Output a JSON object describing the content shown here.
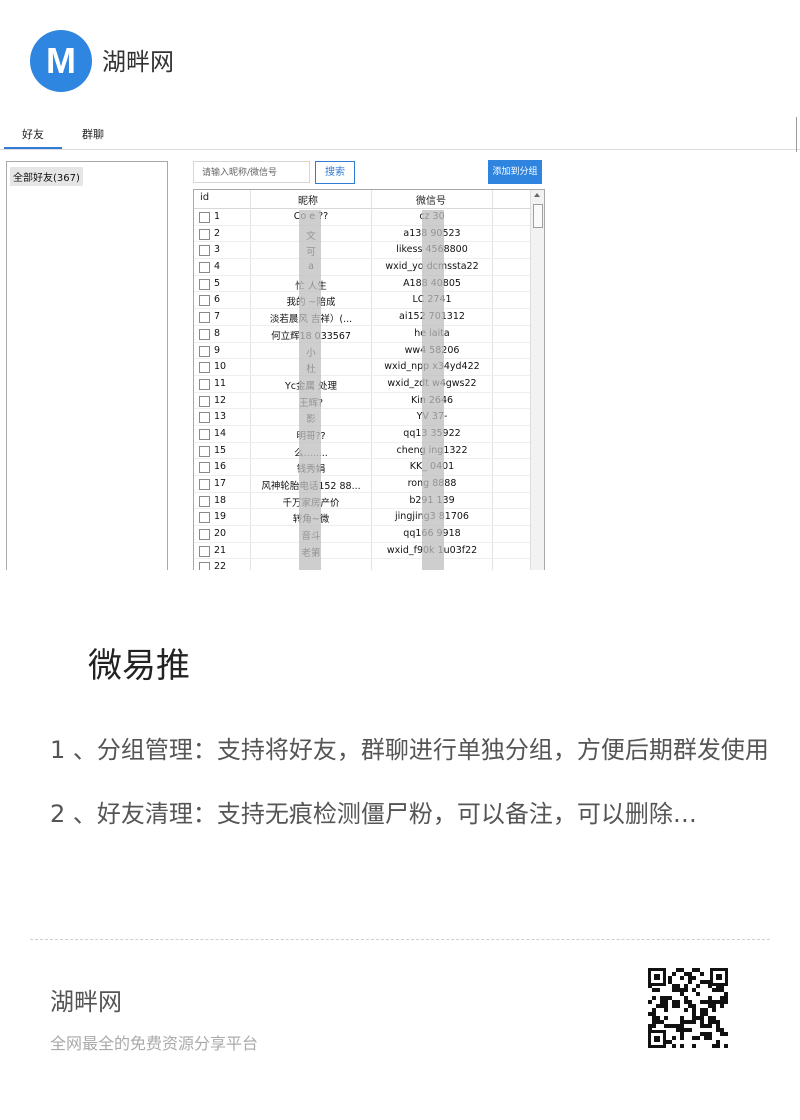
{
  "site": {
    "logo_letter": "M",
    "name": "湖畔网"
  },
  "app": {
    "tabs": [
      "好友",
      "群聊"
    ],
    "group_panel": {
      "items": [
        "全部好友(367)"
      ]
    },
    "search": {
      "placeholder": "请输入昵称/微信号",
      "button": "搜索"
    },
    "add_to_group_button": "添加到分组",
    "table": {
      "columns": [
        "id",
        "昵称",
        "微信号"
      ],
      "rows": [
        {
          "id": "1",
          "nick": "Co    e ??",
          "wx": "cz      30"
        },
        {
          "id": "2",
          "nick": "      文",
          "wx": "a138    90523"
        },
        {
          "id": "3",
          "nick": "     可",
          "wx": "likess     4568800"
        },
        {
          "id": "4",
          "nick": "     a",
          "wx": "wxid_yo     dcmssta22"
        },
        {
          "id": "5",
          "nick": "忙     人生",
          "wx": "A188     40805"
        },
        {
          "id": "6",
          "nick": "我的     ~陪成",
          "wx": "LC     2741"
        },
        {
          "id": "7",
          "nick": "淡若晨风     吉祥）(...",
          "wx": "ai152     701312"
        },
        {
          "id": "8",
          "nick": "何立辉18     033567",
          "wx": "he     iaita"
        },
        {
          "id": "9",
          "nick": "小",
          "wx": "ww4     58206"
        },
        {
          "id": "10",
          "nick": "杜",
          "wx": "wxid_npp     x34yd422"
        },
        {
          "id": "11",
          "nick": "Yc金属     处理",
          "wx": "wxid_zdt     w4gws22"
        },
        {
          "id": "12",
          "nick": "王辉?     ",
          "wx": "Kin     2646"
        },
        {
          "id": "13",
          "nick": "影",
          "wx": "YV     37-"
        },
        {
          "id": "14",
          "nick": "明哥??",
          "wx": "qq13     35922"
        },
        {
          "id": "15",
          "nick": "么........",
          "wx": "cheng     ing1322"
        },
        {
          "id": "16",
          "nick": "钱秀娟",
          "wx": "KK_     0401"
        },
        {
          "id": "17",
          "nick": "风神轮胎电话152     88...",
          "wx": "rong     8888"
        },
        {
          "id": "18",
          "nick": "千万家房产价     ",
          "wx": "b291     139"
        },
        {
          "id": "19",
          "nick": "转角~微     ",
          "wx": "jingjing3     81706"
        },
        {
          "id": "20",
          "nick": "音斗",
          "wx": "qq166     9918"
        },
        {
          "id": "21",
          "nick": "老第",
          "wx": "wxid_f90k     1u03f22"
        },
        {
          "id": "22",
          "nick": "         ",
          "wx": "         "
        }
      ]
    }
  },
  "article": {
    "title": "微易推",
    "summary": "1 、分组管理：支持将好友，群聊进行单独分组，方便后期群发使用2 、好友清理：支持无痕检测僵尸粉，可以备注，可以删除…"
  },
  "footer": {
    "name": "湖畔网",
    "slogan": "全网最全的免费资源分享平台"
  }
}
